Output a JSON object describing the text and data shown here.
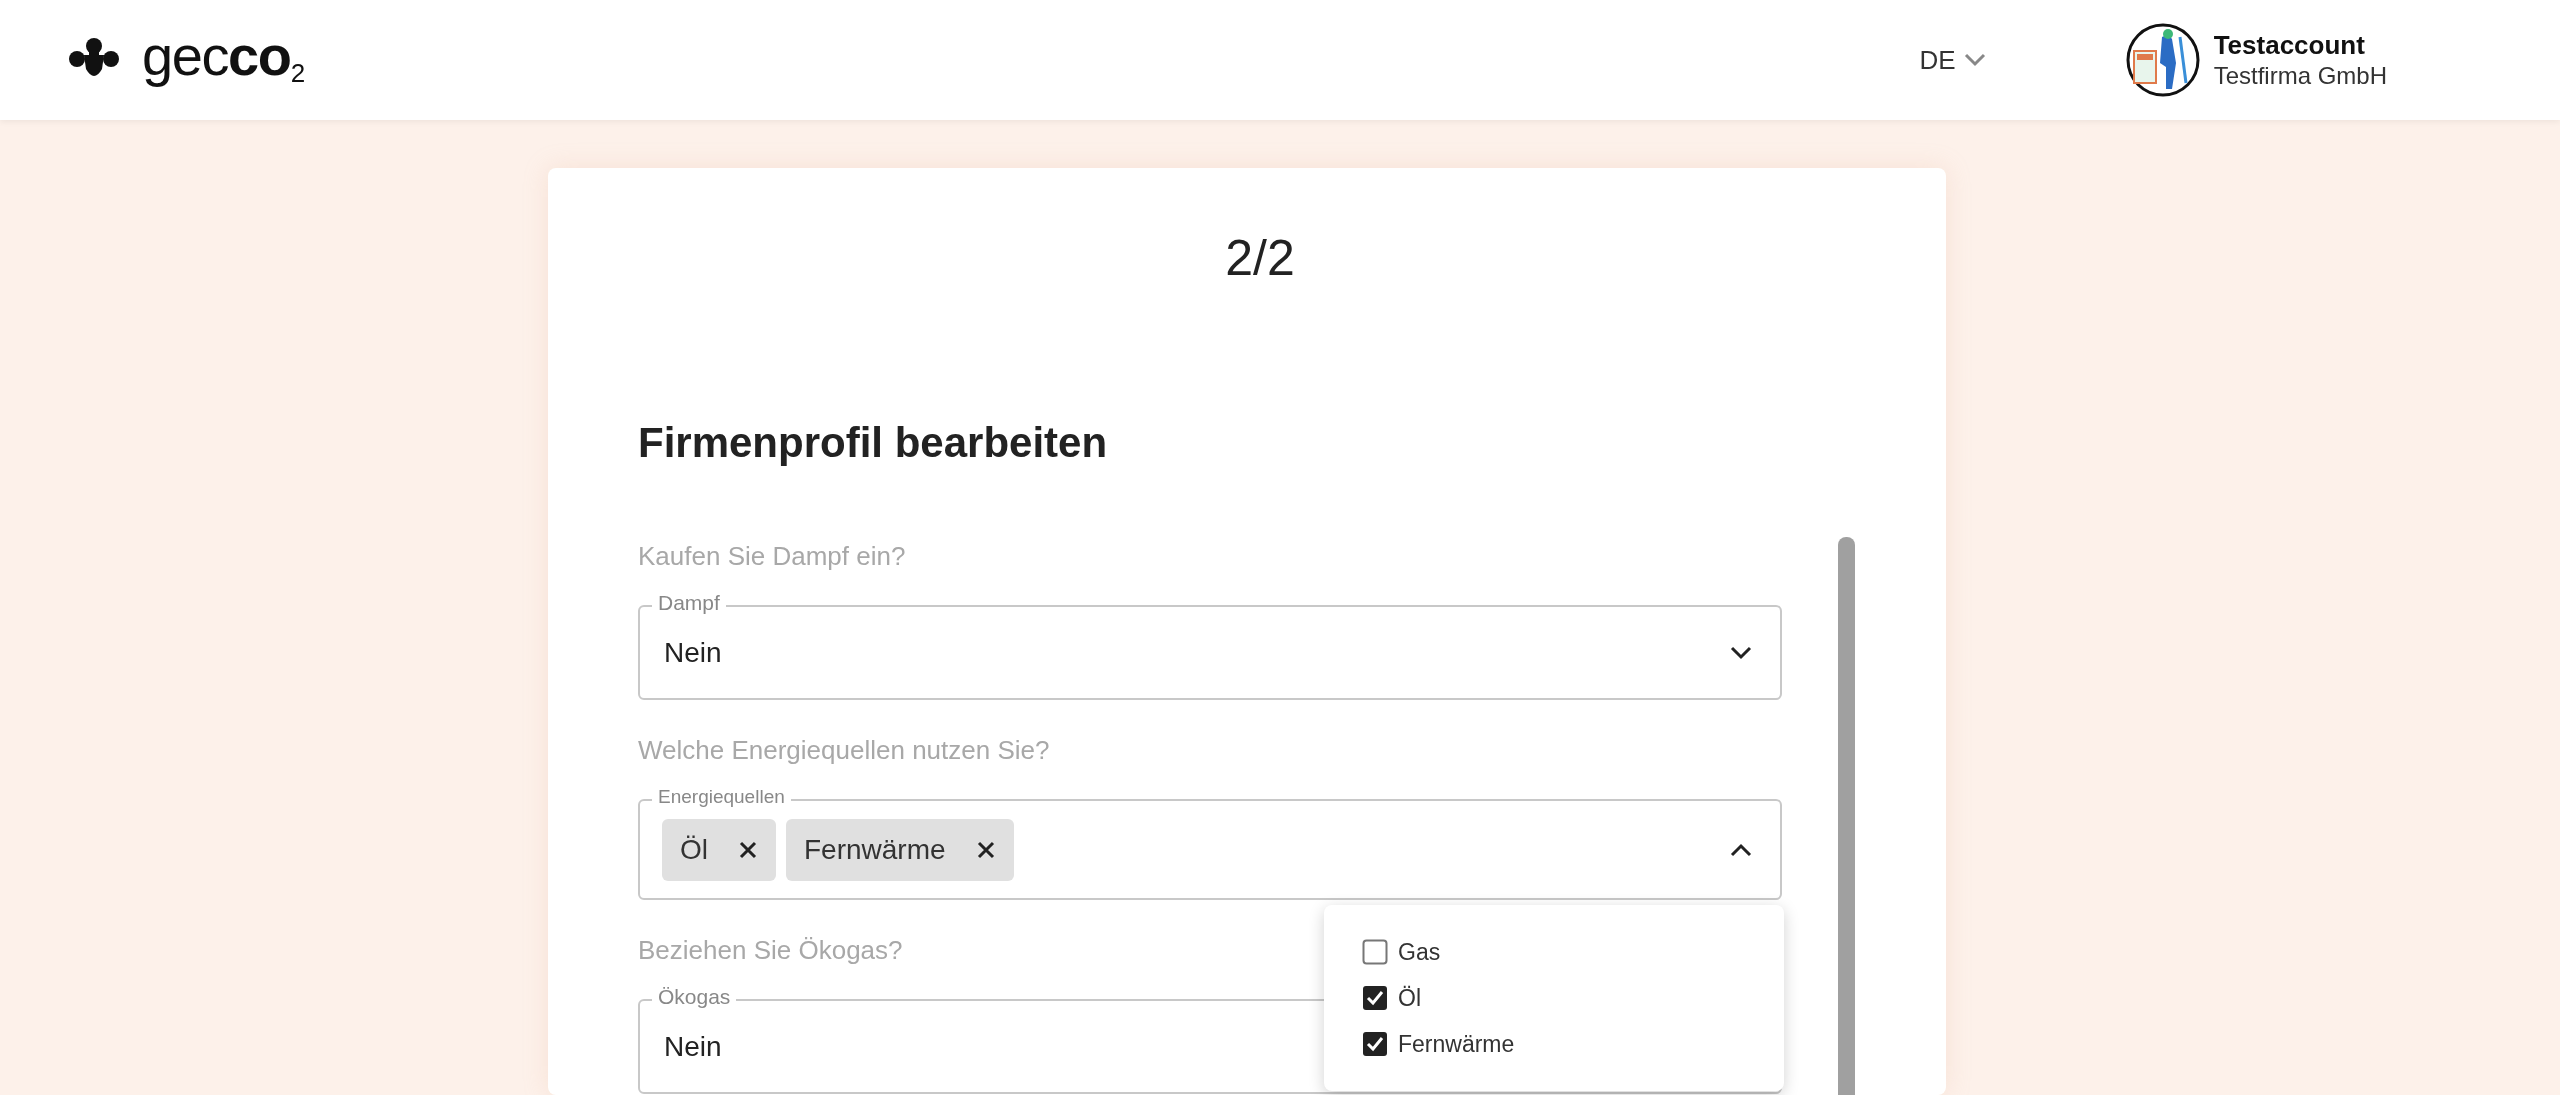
{
  "header": {
    "logo": "gec**co**$_{2}$",
    "language": "DE",
    "user": {
      "name": "Testaccount",
      "company": "Testfirma GmbH"
    }
  },
  "card": {
    "step": "2/2",
    "title": "Firmenprofil bearbeiten",
    "questions": [
      {
        "kind": "select",
        "question": "Kaufen Sie Dampf ein?",
        "label": "Dampf",
        "value": "Nein",
        "expanded": false
      },
      {
        "kind": "multiselect",
        "question": "Welche Energiequellen nutzen Sie?",
        "label": "Energiequellen",
        "expanded": true,
        "chips": [
          "Öl",
          "Fernwärme"
        ],
        "options": [
          {
            "label": "Gas",
            "checked": false
          },
          {
            "label": "Öl",
            "checked": true
          },
          {
            "label": "Fernwärme",
            "checked": true
          }
        ]
      },
      {
        "kind": "select",
        "question": "Beziehen Sie Ökogas?",
        "label": "Ökogas",
        "value": "Nein",
        "expanded": false
      }
    ]
  }
}
